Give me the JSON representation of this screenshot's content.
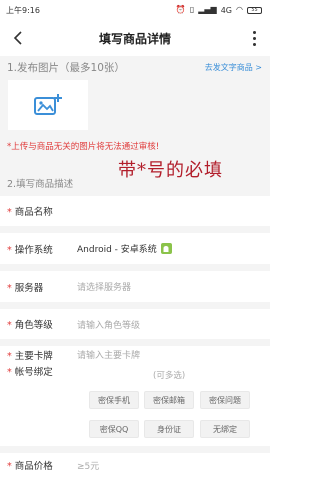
{
  "status_bar": {
    "time": "上午9:16",
    "network": "4G",
    "battery": "55"
  },
  "header": {
    "title": "填写商品详情"
  },
  "section_images": {
    "title": "1.发布图片（最多10张）",
    "link": "去发文字商品 >",
    "warning": "*上传与商品无关的图片将无法通过审核!"
  },
  "section_desc": {
    "title": "2.填写商品描述"
  },
  "annotation": "带*号的必填",
  "form": {
    "product_name": {
      "label": "商品名称"
    },
    "os": {
      "label": "操作系统",
      "value": "Android - 安卓系统"
    },
    "server": {
      "label": "服务器",
      "placeholder": "请选择服务器"
    },
    "role_level": {
      "label": "角色等级",
      "placeholder": "请输入角色等级"
    },
    "main_card": {
      "label": "主要卡牌",
      "placeholder": "请输入主要卡牌"
    },
    "account_binding": {
      "label": "帐号绑定",
      "hint": "(可多选)",
      "options": [
        "密保手机",
        "密保邮箱",
        "密保问题",
        "密保QQ",
        "身份证",
        "无绑定"
      ]
    },
    "price": {
      "label": "商品价格",
      "placeholder": "≥5元"
    }
  },
  "colors": {
    "required": "#e03b3b",
    "link": "#3b8fd8",
    "annotation": "#b21e2b",
    "android": "#8bc34a"
  }
}
